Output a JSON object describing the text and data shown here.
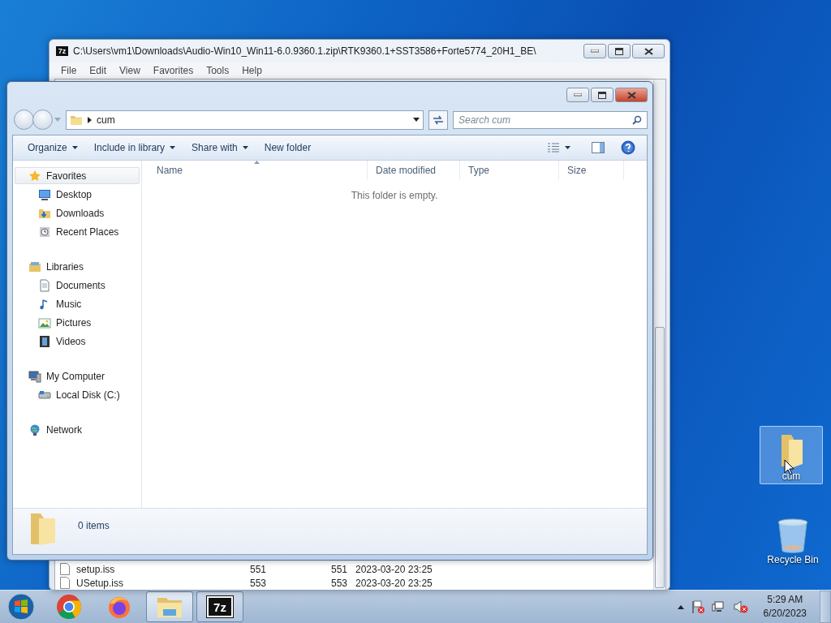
{
  "archive_window": {
    "icon_label": "7z",
    "title": "C:\\Users\\vm1\\Downloads\\Audio-Win10_Win11-6.0.9360.1.zip\\RTK9360.1+SST3586+Forte5774_20H1_BE\\",
    "menu": [
      "File",
      "Edit",
      "View",
      "Favorites",
      "Tools",
      "Help"
    ],
    "rows": [
      {
        "column_1": "setup.iss",
        "column_2": "551",
        "column_3": "551",
        "column_4": "2023-03-20 23:25"
      },
      {
        "column_1": "USetup.iss",
        "column_2": "553",
        "column_3": "553",
        "column_4": "2023-03-20 23:25"
      }
    ]
  },
  "explorer": {
    "path": [
      "cum"
    ],
    "search": {
      "placeholder": "Search cum"
    },
    "toolbar": [
      {
        "label": "Organize",
        "dropdown": true
      },
      {
        "label": "Include in library",
        "dropdown": true
      },
      {
        "label": "Share with",
        "dropdown": true
      },
      {
        "label": "New folder",
        "dropdown": false
      }
    ],
    "columns": [
      "Name",
      "Date modified",
      "Type",
      "Size"
    ],
    "empty_message": "This folder is empty.",
    "nav": [
      {
        "label": "Favorites",
        "kind": "star",
        "selected": true,
        "children": [
          {
            "label": "Desktop",
            "kind": "desktop",
            "selected": false
          },
          {
            "label": "Downloads",
            "kind": "downloads",
            "selected": false
          },
          {
            "label": "Recent Places",
            "kind": "recent",
            "selected": false
          }
        ]
      },
      {
        "label": "Libraries",
        "kind": "library",
        "selected": false,
        "children": [
          {
            "label": "Documents",
            "kind": "document",
            "selected": false
          },
          {
            "label": "Music",
            "kind": "music",
            "selected": false
          },
          {
            "label": "Pictures",
            "kind": "pictures",
            "selected": false
          },
          {
            "label": "Videos",
            "kind": "video",
            "selected": false
          }
        ]
      },
      {
        "label": "My Computer",
        "kind": "computer",
        "selected": false,
        "children": [
          {
            "label": "Local Disk (C:)",
            "kind": "disk",
            "selected": false
          }
        ]
      },
      {
        "label": "Network",
        "kind": "network",
        "selected": false
      }
    ],
    "details": {
      "count": "0 items"
    }
  },
  "desktop_icons": [
    {
      "label": "cum",
      "kind": "folder",
      "selected": true
    },
    {
      "label": "Recycle Bin",
      "kind": "bin",
      "selected": false
    }
  ],
  "taskbar": {
    "apps": [
      {
        "kind": "chrome",
        "selected": false
      },
      {
        "kind": "firefox",
        "selected": false
      },
      {
        "kind": "explorer",
        "selected": true
      },
      {
        "kind": "sevenzip",
        "selected": false,
        "label": "7z"
      }
    ],
    "clock": {
      "time": "5:29 AM",
      "date": "6/20/2023"
    }
  }
}
